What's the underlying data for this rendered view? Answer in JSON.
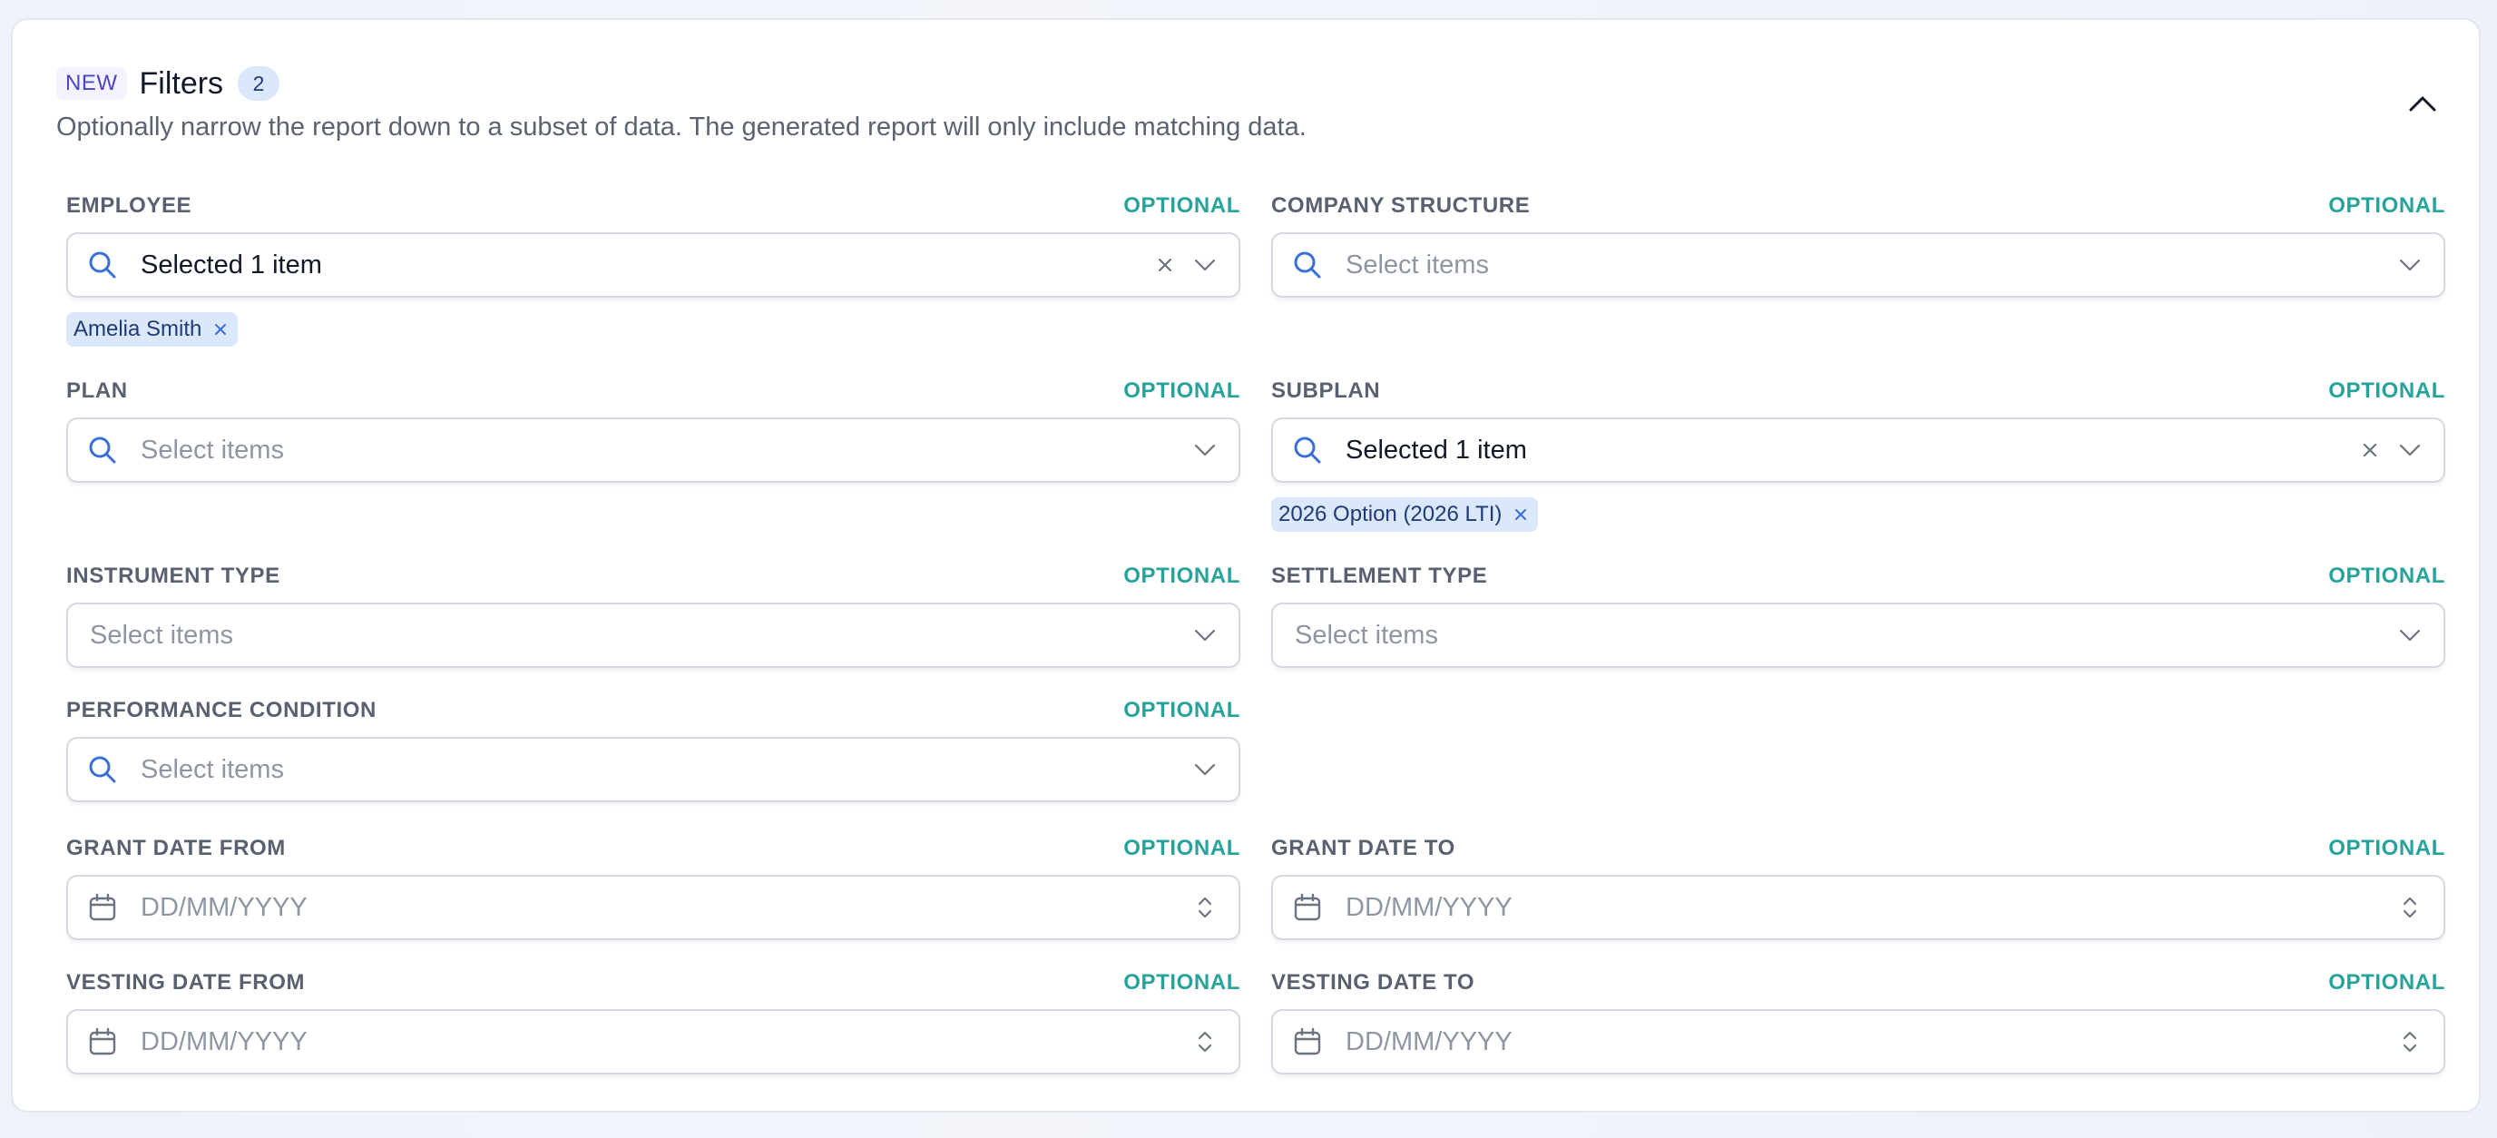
{
  "header": {
    "new_badge": "NEW",
    "title": "Filters",
    "count": "2",
    "subtitle": "Optionally narrow the report down to a subset of data. The generated report will only include matching data."
  },
  "optional_label": "OPTIONAL",
  "fields": {
    "employee": {
      "label": "EMPLOYEE",
      "value": "Selected 1 item",
      "chips": [
        "Amelia Smith"
      ]
    },
    "company_structure": {
      "label": "COMPANY STRUCTURE",
      "placeholder": "Select items"
    },
    "plan": {
      "label": "PLAN",
      "placeholder": "Select items"
    },
    "subplan": {
      "label": "SUBPLAN",
      "value": "Selected 1 item",
      "chips": [
        "2026 Option (2026 LTI)"
      ]
    },
    "instrument_type": {
      "label": "INSTRUMENT TYPE",
      "placeholder": "Select items"
    },
    "settlement_type": {
      "label": "SETTLEMENT TYPE",
      "placeholder": "Select items"
    },
    "performance_condition": {
      "label": "PERFORMANCE CONDITION",
      "placeholder": "Select items"
    },
    "grant_date_from": {
      "label": "GRANT DATE FROM",
      "placeholder": "DD/MM/YYYY"
    },
    "grant_date_to": {
      "label": "GRANT DATE TO",
      "placeholder": "DD/MM/YYYY"
    },
    "vesting_date_from": {
      "label": "VESTING DATE FROM",
      "placeholder": "DD/MM/YYYY"
    },
    "vesting_date_to": {
      "label": "VESTING DATE TO",
      "placeholder": "DD/MM/YYYY"
    }
  },
  "icons": {
    "search": "search-icon",
    "calendar": "calendar-icon",
    "clear": "clear-icon",
    "chevron_down": "chevron-down-icon",
    "chevron_up": "chevron-up-icon",
    "stepper": "stepper-icon"
  },
  "colors": {
    "accent_blue": "#3b6fd8",
    "optional_teal": "#27a39b",
    "chip_bg": "#dbe7fb",
    "new_purple": "#4b45c8"
  }
}
